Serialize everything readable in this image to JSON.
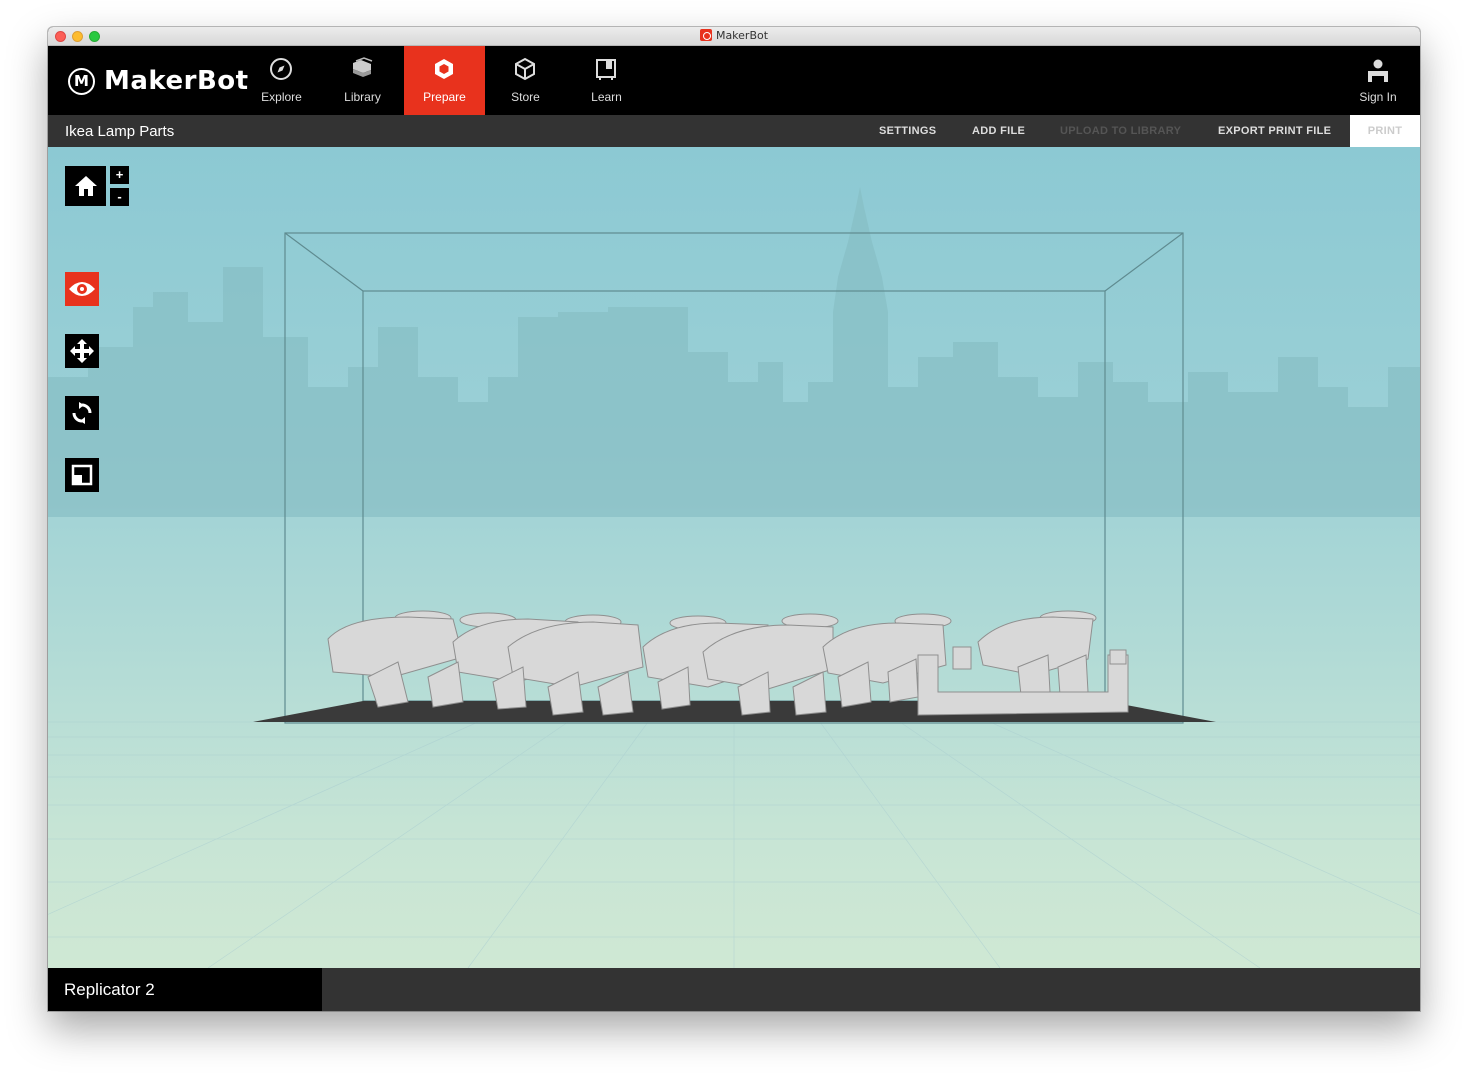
{
  "window": {
    "title": "MakerBot"
  },
  "brand": {
    "name": "MakerBot"
  },
  "nav": {
    "items": [
      {
        "label": "Explore",
        "icon": "compass-icon",
        "active": false
      },
      {
        "label": "Library",
        "icon": "library-icon",
        "active": false
      },
      {
        "label": "Prepare",
        "icon": "prepare-icon",
        "active": true
      },
      {
        "label": "Store",
        "icon": "store-box-icon",
        "active": false
      },
      {
        "label": "Learn",
        "icon": "learn-book-icon",
        "active": false
      }
    ],
    "sign_in": "Sign In"
  },
  "toolbar": {
    "project_title": "Ikea Lamp Parts",
    "settings": "SETTINGS",
    "add_file": "ADD FILE",
    "upload_to_library": "UPLOAD TO LIBRARY",
    "export_print_file": "EXPORT PRINT FILE",
    "print": "PRINT"
  },
  "view_controls": {
    "zoom_in": "+",
    "zoom_out": "-",
    "tools": [
      "eye-icon",
      "move-icon",
      "rotate-icon",
      "scale-icon"
    ]
  },
  "status": {
    "printer": "Replicator 2"
  },
  "colors": {
    "accent": "#e8321d",
    "toolbar": "#333333",
    "nav": "#000000"
  }
}
